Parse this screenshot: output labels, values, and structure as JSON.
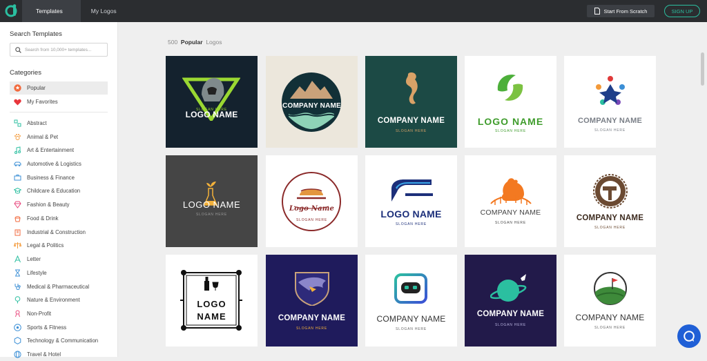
{
  "topbar": {
    "tabs": [
      {
        "label": "Templates",
        "active": true
      },
      {
        "label": "My Logos",
        "active": false
      }
    ],
    "start_scratch": "Start From Scratch",
    "sign_up": "SIGN UP"
  },
  "sidebar": {
    "search_heading": "Search Templates",
    "search_placeholder": "Search from 10,000+ templates...",
    "categories_heading": "Categories",
    "special": [
      {
        "label": "Popular",
        "icon": "star-badge-icon",
        "active": true
      },
      {
        "label": "My Favorites",
        "icon": "heart-icon",
        "active": false
      }
    ],
    "categories": [
      {
        "label": "Abstract",
        "icon": "abstract-icon"
      },
      {
        "label": "Animal & Pet",
        "icon": "paw-icon"
      },
      {
        "label": "Art & Entertainment",
        "icon": "music-note-icon"
      },
      {
        "label": "Automotive & Logistics",
        "icon": "car-icon"
      },
      {
        "label": "Business & Finance",
        "icon": "briefcase-icon"
      },
      {
        "label": "Childcare & Education",
        "icon": "graduation-cap-icon"
      },
      {
        "label": "Fashion & Beauty",
        "icon": "diamond-icon"
      },
      {
        "label": "Food & Drink",
        "icon": "cupcake-icon"
      },
      {
        "label": "Industrial & Construction",
        "icon": "building-icon"
      },
      {
        "label": "Legal & Politics",
        "icon": "scales-icon"
      },
      {
        "label": "Letter",
        "icon": "letter-a-icon"
      },
      {
        "label": "Lifestyle",
        "icon": "lifestyle-icon"
      },
      {
        "label": "Medical & Pharmaceutical",
        "icon": "stethoscope-icon"
      },
      {
        "label": "Nature & Environment",
        "icon": "tree-icon"
      },
      {
        "label": "Non-Profit",
        "icon": "ribbon-icon"
      },
      {
        "label": "Sports & Fitness",
        "icon": "soccer-ball-icon"
      },
      {
        "label": "Technology & Communication",
        "icon": "hexagon-icon"
      },
      {
        "label": "Travel & Hotel",
        "icon": "globe-icon"
      }
    ]
  },
  "main": {
    "count": "500",
    "count_bold": "Popular",
    "count_suffix": "Logos",
    "logos": [
      {
        "name": "LOGO NAME",
        "slogan": "SLOGAN HERE",
        "bg": "#14222e"
      },
      {
        "name": "COMPANY NAME",
        "slogan": "",
        "bg": "#ece7dc"
      },
      {
        "name": "COMPANY NAME",
        "slogan": "SLOGAN HERE",
        "bg": "#1c4a45"
      },
      {
        "name": "LOGO NAME",
        "slogan": "SLOGAN HERE",
        "bg": "#ffffff"
      },
      {
        "name": "COMPANY NAME",
        "slogan": "SLOGAN HERE",
        "bg": "#ffffff"
      },
      {
        "name": "LOGO NAME",
        "slogan": "SLOGAN HERE",
        "bg": "#454545"
      },
      {
        "name": "Logo Name",
        "slogan": "SLOGAN HERE",
        "bg": "#ffffff"
      },
      {
        "name": "LOGO NAME",
        "slogan": "SLOGAN HERE",
        "bg": "#ffffff"
      },
      {
        "name": "COMPANY NAME",
        "slogan": "SLOGAN HERE",
        "bg": "#ffffff"
      },
      {
        "name": "COMPANY NAME",
        "slogan": "SLOGAN HERE",
        "bg": "#ffffff"
      },
      {
        "name": "LOGO",
        "name2": "NAME",
        "slogan": "",
        "bg": "#ffffff"
      },
      {
        "name": "COMPANY NAME",
        "slogan": "SLOGAN HERE",
        "bg": "#1f1b5c"
      },
      {
        "name": "COMPANY NAME",
        "slogan": "SLOGAN HERE",
        "bg": "#ffffff"
      },
      {
        "name": "COMPANY NAME",
        "slogan": "SLOGAN HERE",
        "bg": "#221a4a"
      },
      {
        "name": "COMPANY NAME",
        "slogan": "SLOGAN HERE",
        "bg": "#ffffff"
      }
    ]
  },
  "colors": {
    "accent": "#2bbfa0",
    "topbar": "#2b2d30",
    "chat": "#1f5fd6"
  }
}
